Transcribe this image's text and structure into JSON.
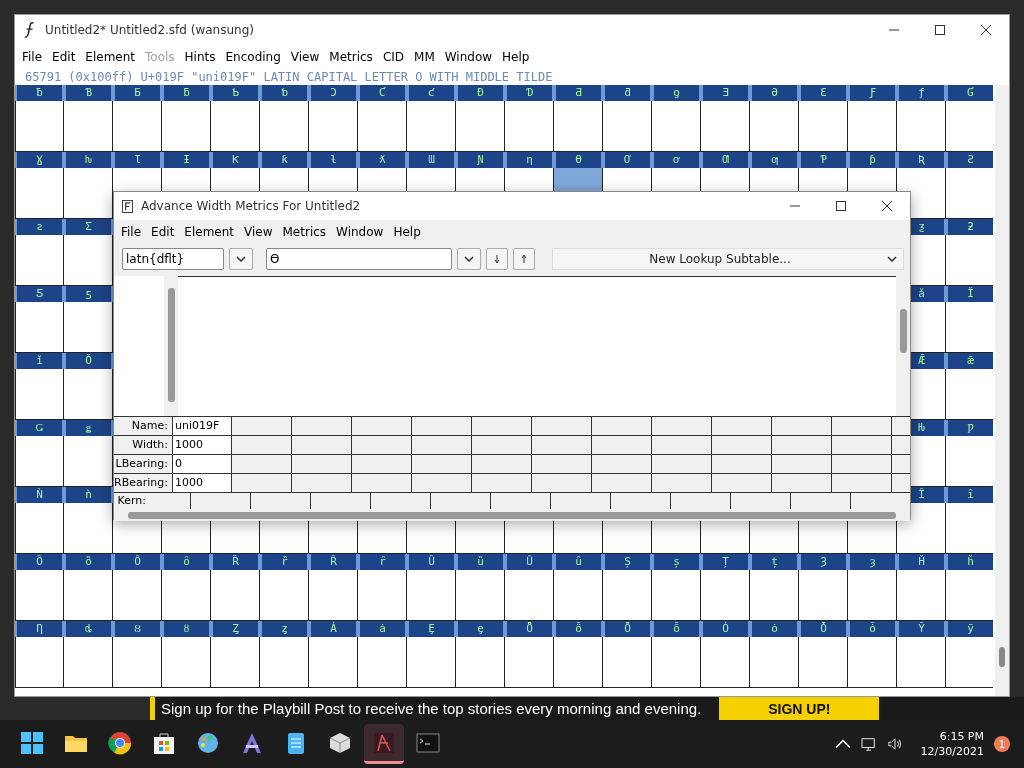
{
  "main_window": {
    "title": "Untitled2*  Untitled2.sfd (wansung)",
    "menu": [
      {
        "label": "File",
        "disabled": false
      },
      {
        "label": "Edit",
        "disabled": false
      },
      {
        "label": "Element",
        "disabled": false
      },
      {
        "label": "Tools",
        "disabled": true
      },
      {
        "label": "Hints",
        "disabled": false
      },
      {
        "label": "Encoding",
        "disabled": false
      },
      {
        "label": "View",
        "disabled": false
      },
      {
        "label": "Metrics",
        "disabled": false
      },
      {
        "label": "CID",
        "disabled": false
      },
      {
        "label": "MM",
        "disabled": false
      },
      {
        "label": "Window",
        "disabled": false
      },
      {
        "label": "Help",
        "disabled": false
      }
    ],
    "info_line": "65791 (0x100ff) U+019F \"uni019F\" LATIN CAPITAL LETTER O WITH MIDDLE TILDE",
    "glyph_rows": [
      {
        "kind": "full",
        "glyphs": [
          {
            "g": "ƀ",
            "selected": false
          },
          {
            "g": "Ɓ",
            "selected": false
          },
          {
            "g": "Ƃ",
            "selected": false
          },
          {
            "g": "ƃ",
            "selected": false
          },
          {
            "g": "Ƅ",
            "selected": false
          },
          {
            "g": "ƅ",
            "selected": false
          },
          {
            "g": "Ɔ",
            "selected": false
          },
          {
            "g": "Ƈ",
            "selected": false
          },
          {
            "g": "ƈ",
            "selected": false
          },
          {
            "g": "Ɖ",
            "selected": false
          },
          {
            "g": "Ɗ",
            "selected": false
          },
          {
            "g": "Ƌ",
            "selected": false
          },
          {
            "g": "ƌ",
            "selected": false
          },
          {
            "g": "ƍ",
            "selected": false
          },
          {
            "g": "Ǝ",
            "selected": false
          },
          {
            "g": "Ə",
            "selected": false
          },
          {
            "g": "Ɛ",
            "selected": false
          },
          {
            "g": "Ƒ",
            "selected": false
          },
          {
            "g": "ƒ",
            "selected": false
          },
          {
            "g": "Ɠ",
            "selected": false
          }
        ]
      },
      {
        "kind": "full",
        "glyphs": [
          {
            "g": "Ɣ",
            "selected": false
          },
          {
            "g": "ƕ",
            "selected": false
          },
          {
            "g": "Ɩ",
            "selected": false
          },
          {
            "g": "Ɨ",
            "selected": false
          },
          {
            "g": "Ƙ",
            "selected": false
          },
          {
            "g": "ƙ",
            "selected": false
          },
          {
            "g": "ƚ",
            "selected": false
          },
          {
            "g": "ƛ",
            "selected": false
          },
          {
            "g": "Ɯ",
            "selected": false
          },
          {
            "g": "Ɲ",
            "selected": false
          },
          {
            "g": "ƞ",
            "selected": false
          },
          {
            "g": "Ɵ",
            "selected": true
          },
          {
            "g": "Ơ",
            "selected": false
          },
          {
            "g": "ơ",
            "selected": false
          },
          {
            "g": "Ƣ",
            "selected": false
          },
          {
            "g": "ƣ",
            "selected": false
          },
          {
            "g": "Ƥ",
            "selected": false
          },
          {
            "g": "ƥ",
            "selected": false
          },
          {
            "g": "Ʀ",
            "selected": false
          },
          {
            "g": "Ƨ",
            "selected": false
          }
        ]
      },
      {
        "kind": "split",
        "left": [
          {
            "g": "ƨ",
            "selected": false
          },
          {
            "g": "Ʃ",
            "selected": false
          }
        ],
        "right": [
          {
            "g": "ƺ",
            "selected": false
          },
          {
            "g": "ƻ",
            "selected": false
          }
        ]
      },
      {
        "kind": "split",
        "left": [
          {
            "g": "Ƽ",
            "selected": false
          },
          {
            "g": "ƽ",
            "selected": false
          }
        ],
        "right": [
          {
            "g": "ǎ",
            "selected": false
          },
          {
            "g": "Ǐ",
            "selected": false
          }
        ]
      },
      {
        "kind": "split",
        "left": [
          {
            "g": "ǐ",
            "selected": false
          },
          {
            "g": "Ǒ",
            "selected": false
          }
        ],
        "right": [
          {
            "g": "Ǣ",
            "selected": false
          },
          {
            "g": "ǣ",
            "selected": false
          }
        ]
      },
      {
        "kind": "split",
        "left": [
          {
            "g": "Ǥ",
            "selected": false
          },
          {
            "g": "ǥ",
            "selected": false
          }
        ],
        "right": [
          {
            "g": "Ƕ",
            "selected": false
          },
          {
            "g": "Ƿ",
            "selected": false
          }
        ]
      },
      {
        "kind": "split",
        "left": [
          {
            "g": "Ǹ",
            "selected": false
          },
          {
            "g": "ǹ",
            "selected": false
          }
        ],
        "right": [
          {
            "g": "Ȋ",
            "selected": false
          },
          {
            "g": "ȋ",
            "selected": false
          }
        ]
      },
      {
        "kind": "full",
        "glyphs": [
          {
            "g": "Ȍ",
            "selected": false
          },
          {
            "g": "ȍ",
            "selected": false
          },
          {
            "g": "Ȏ",
            "selected": false
          },
          {
            "g": "ȏ",
            "selected": false
          },
          {
            "g": "Ȑ",
            "selected": false
          },
          {
            "g": "ȑ",
            "selected": false
          },
          {
            "g": "Ȓ",
            "selected": false
          },
          {
            "g": "ȓ",
            "selected": false
          },
          {
            "g": "Ȕ",
            "selected": false
          },
          {
            "g": "ȕ",
            "selected": false
          },
          {
            "g": "Ȗ",
            "selected": false
          },
          {
            "g": "ȗ",
            "selected": false
          },
          {
            "g": "Ș",
            "selected": false
          },
          {
            "g": "ș",
            "selected": false
          },
          {
            "g": "Ț",
            "selected": false
          },
          {
            "g": "ț",
            "selected": false
          },
          {
            "g": "Ȝ",
            "selected": false
          },
          {
            "g": "ȝ",
            "selected": false
          },
          {
            "g": "Ȟ",
            "selected": false
          },
          {
            "g": "ȟ",
            "selected": false
          }
        ]
      },
      {
        "kind": "full",
        "glyphs": [
          {
            "g": "Ƞ",
            "selected": false
          },
          {
            "g": "ȡ",
            "selected": false
          },
          {
            "g": "Ȣ",
            "selected": false
          },
          {
            "g": "ȣ",
            "selected": false
          },
          {
            "g": "Ȥ",
            "selected": false
          },
          {
            "g": "ȥ",
            "selected": false
          },
          {
            "g": "Ȧ",
            "selected": false
          },
          {
            "g": "ȧ",
            "selected": false
          },
          {
            "g": "Ȩ",
            "selected": false
          },
          {
            "g": "ȩ",
            "selected": false
          },
          {
            "g": "Ȫ",
            "selected": false
          },
          {
            "g": "ȫ",
            "selected": false
          },
          {
            "g": "Ȭ",
            "selected": false
          },
          {
            "g": "ȭ",
            "selected": false
          },
          {
            "g": "Ȯ",
            "selected": false
          },
          {
            "g": "ȯ",
            "selected": false
          },
          {
            "g": "Ȱ",
            "selected": false
          },
          {
            "g": "ȱ",
            "selected": false
          },
          {
            "g": "Ȳ",
            "selected": false
          },
          {
            "g": "ȳ",
            "selected": false
          }
        ]
      }
    ]
  },
  "dialog": {
    "title": "Advance Width Metrics For Untitled2",
    "menu": [
      "File",
      "Edit",
      "Element",
      "View",
      "Metrics",
      "Window",
      "Help"
    ],
    "script_field": "latn{dflt}",
    "glyph_field": "Ɵ",
    "subtable_select": "New Lookup Subtable...",
    "metrics": [
      {
        "label": "Name:",
        "value": "uni019F"
      },
      {
        "label": "Width:",
        "value": "1000"
      },
      {
        "label": "LBearing:",
        "value": "0"
      },
      {
        "label": "RBearing:",
        "value": "1000"
      }
    ],
    "kern_label": "Kern:"
  },
  "ad_banner": {
    "text": "Sign up for the Playbill Post to receive the top stories every morning and evening.",
    "button": "SIGN UP!"
  },
  "taskbar": {
    "apps": [
      {
        "kind": "start",
        "selected": false
      },
      {
        "kind": "folder",
        "selected": false
      },
      {
        "kind": "browser",
        "selected": false
      },
      {
        "kind": "store",
        "selected": false
      },
      {
        "kind": "palette",
        "selected": false
      },
      {
        "kind": "letter",
        "selected": false
      },
      {
        "kind": "notepad",
        "selected": false
      },
      {
        "kind": "cube",
        "selected": false
      },
      {
        "kind": "font",
        "selected": true
      },
      {
        "kind": "terminal",
        "selected": false
      }
    ],
    "time": "6:15 PM",
    "date": "12/30/2021",
    "notification_count": "1"
  }
}
